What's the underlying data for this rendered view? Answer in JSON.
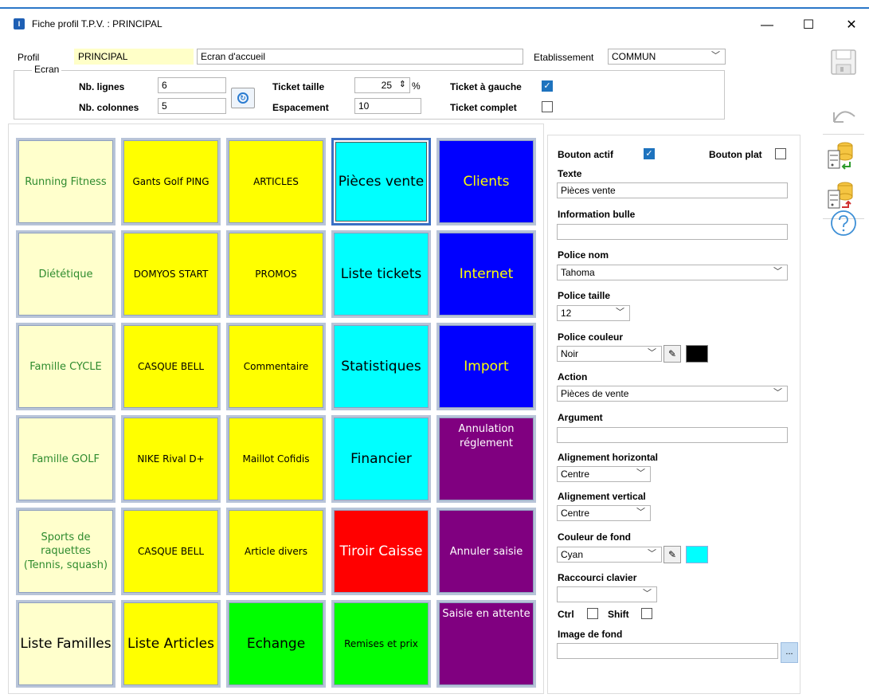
{
  "window": {
    "title": "Fiche profil T.P.V. : PRINCIPAL",
    "app_icon": "app-icon",
    "minimize": "—",
    "maximize": "☐",
    "close": "✕"
  },
  "header": {
    "profil_label": "Profil",
    "profil_value": "PRINCIPAL",
    "profil_desc": "Ecran d'accueil",
    "etab_label": "Etablissement",
    "etab_value": "COMMUN"
  },
  "ecran": {
    "group_label": "Ecran",
    "nb_lignes_label": "Nb. lignes",
    "nb_lignes_value": "6",
    "nb_colonnes_label": "Nb. colonnes",
    "nb_colonnes_value": "5",
    "ticket_taille_label": "Ticket taille",
    "ticket_taille_value": "25",
    "ticket_taille_unit": "%",
    "espacement_label": "Espacement",
    "espacement_value": "10",
    "ticket_gauche_label": "Ticket à gauche",
    "ticket_gauche_checked": true,
    "ticket_complet_label": "Ticket complet",
    "ticket_complet_checked": false
  },
  "tiles": [
    {
      "label": "Running Fitness",
      "bg": "#ffffcc",
      "fg": "#2e8b2e"
    },
    {
      "label": "Gants Golf PING",
      "bg": "#ffff00",
      "fg": "#000000"
    },
    {
      "label": "ARTICLES",
      "bg": "#ffff00",
      "fg": "#000000"
    },
    {
      "label": "Pièces vente",
      "bg": "#00ffff",
      "fg": "#000000"
    },
    {
      "label": "Clients",
      "bg": "#0000ff",
      "fg": "#ffff00"
    },
    {
      "label": "Diététique",
      "bg": "#ffffcc",
      "fg": "#2e8b2e"
    },
    {
      "label": "DOMYOS START",
      "bg": "#ffff00",
      "fg": "#000000"
    },
    {
      "label": "PROMOS",
      "bg": "#ffff00",
      "fg": "#000000"
    },
    {
      "label": "Liste tickets",
      "bg": "#00ffff",
      "fg": "#000000"
    },
    {
      "label": "Internet",
      "bg": "#0000ff",
      "fg": "#ffff00"
    },
    {
      "label": "Famille CYCLE",
      "bg": "#ffffcc",
      "fg": "#2e8b2e"
    },
    {
      "label": "CASQUE BELL",
      "bg": "#ffff00",
      "fg": "#000000"
    },
    {
      "label": "Commentaire",
      "bg": "#ffff00",
      "fg": "#000000"
    },
    {
      "label": "Statistiques",
      "bg": "#00ffff",
      "fg": "#000000"
    },
    {
      "label": "Import",
      "bg": "#0000ff",
      "fg": "#ffff00"
    },
    {
      "label": "Famille GOLF",
      "bg": "#ffffcc",
      "fg": "#2e8b2e"
    },
    {
      "label": "NIKE Rival D+",
      "bg": "#ffff00",
      "fg": "#000000"
    },
    {
      "label": "Maillot Cofidis",
      "bg": "#ffff00",
      "fg": "#000000"
    },
    {
      "label": "Financier",
      "bg": "#00ffff",
      "fg": "#000000"
    },
    {
      "label": "Annulation réglement",
      "bg": "#800080",
      "fg": "#ffffff"
    },
    {
      "label": "Sports de raquettes (Tennis, squash)",
      "bg": "#ffffcc",
      "fg": "#2e8b2e"
    },
    {
      "label": "CASQUE BELL",
      "bg": "#ffff00",
      "fg": "#000000"
    },
    {
      "label": "Article divers",
      "bg": "#ffff00",
      "fg": "#000000"
    },
    {
      "label": "Tiroir Caisse",
      "bg": "#ff0000",
      "fg": "#ffffff"
    },
    {
      "label": "Annuler saisie",
      "bg": "#800080",
      "fg": "#ffffff"
    },
    {
      "label": "Liste Familles",
      "bg": "#ffffcc",
      "fg": "#000000"
    },
    {
      "label": "Liste Articles",
      "bg": "#ffff00",
      "fg": "#000000"
    },
    {
      "label": "Echange",
      "bg": "#00ff00",
      "fg": "#000000"
    },
    {
      "label": "Remises et prix",
      "bg": "#00ff00",
      "fg": "#000000"
    },
    {
      "label": "Saisie en attente",
      "bg": "#800080",
      "fg": "#ffffff"
    }
  ],
  "props": {
    "bouton_actif_label": "Bouton actif",
    "bouton_actif_checked": true,
    "bouton_plat_label": "Bouton plat",
    "bouton_plat_checked": false,
    "texte_label": "Texte",
    "texte_value": "Pièces vente",
    "info_bulle_label": "Information bulle",
    "info_bulle_value": "",
    "police_nom_label": "Police nom",
    "police_nom_value": "Tahoma",
    "police_taille_label": "Police taille",
    "police_taille_value": "12",
    "police_couleur_label": "Police couleur",
    "police_couleur_value": "Noir",
    "police_couleur_swatch": "#000000",
    "action_label": "Action",
    "action_value": "Pièces de vente",
    "argument_label": "Argument",
    "argument_value": "",
    "align_h_label": "Alignement horizontal",
    "align_h_value": "Centre",
    "align_v_label": "Alignement vertical",
    "align_v_value": "Centre",
    "couleur_fond_label": "Couleur de fond",
    "couleur_fond_value": "Cyan",
    "couleur_fond_swatch": "#00ffff",
    "raccourci_label": "Raccourci clavier",
    "raccourci_value": "",
    "ctrl_label": "Ctrl",
    "shift_label": "Shift",
    "image_fond_label": "Image de fond",
    "image_fond_value": "",
    "browse_label": "..."
  },
  "toolbar": {
    "save": "save-icon",
    "undo": "undo-icon",
    "db_import": "database-import-icon",
    "db_export": "database-export-icon",
    "help": "help-icon"
  }
}
